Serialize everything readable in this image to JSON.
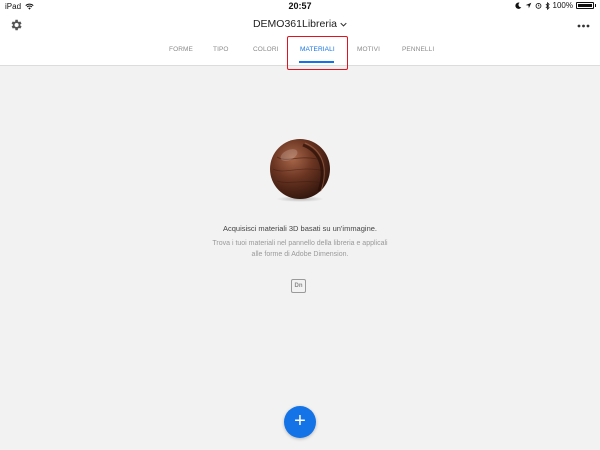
{
  "status_bar": {
    "device": "iPad",
    "time": "20:57",
    "battery_percent": "100%",
    "battery_level": 1.0
  },
  "header": {
    "title": "DEMO361Libreria",
    "settings_icon": "gear-icon",
    "more_icon": "more-horizontal-icon"
  },
  "tabs": [
    {
      "label": "FORME",
      "active": false
    },
    {
      "label": "TIPO",
      "active": false
    },
    {
      "label": "COLORI",
      "active": false
    },
    {
      "label": "MATERIALI",
      "active": true
    },
    {
      "label": "MOTIVI",
      "active": false
    },
    {
      "label": "PENNELLI",
      "active": false
    }
  ],
  "empty_state": {
    "title": "Acquisisci materiali 3D basati su un'immagine.",
    "description_line1": "Trova i tuoi materiali nel pannello della libreria e applicali",
    "description_line2": "alle forme di Adobe Dimension.",
    "app_badge": "Dn"
  },
  "fab": {
    "label": "+"
  },
  "colors": {
    "accent": "#1473e6",
    "highlight": "#e0141e",
    "background": "#f2f2f2"
  }
}
